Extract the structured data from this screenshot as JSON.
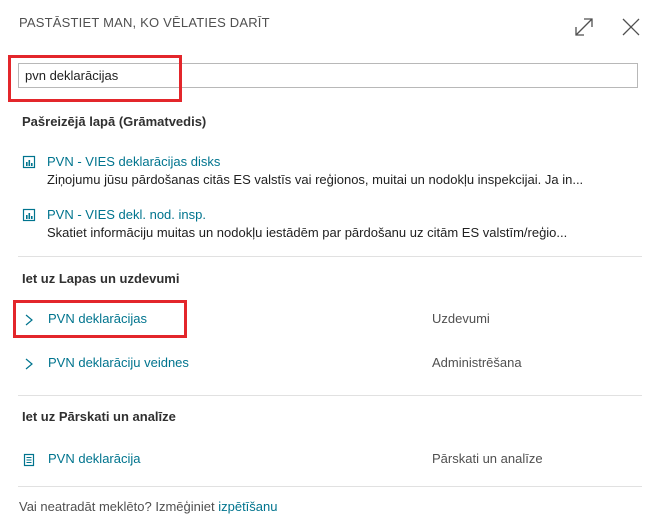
{
  "header": {
    "title": "PASTĀSTIET MAN, KO VĒLATIES DARĪT"
  },
  "search": {
    "value": "pvn deklarācijas"
  },
  "sections": {
    "current_page": {
      "title": "Pašreizējā lapā (Grāmatvedis)",
      "items": [
        {
          "title": "PVN - VIES deklarācijas disks",
          "description": "Ziņojumu jūsu pārdošanas citās ES valstīs vai reģionos, muitai un nodokļu inspekcijai. Ja in...",
          "icon": "report-icon"
        },
        {
          "title": "PVN - VIES dekl. nod. insp.",
          "description": "Skatiet informāciju muitas un nodokļu iestādēm par pārdošanu uz citām ES valstīm/reģio...",
          "icon": "report-icon"
        }
      ]
    },
    "pages_tasks": {
      "title": "Iet uz Lapas un uzdevumi",
      "items": [
        {
          "title": "PVN deklarācijas",
          "category": "Uzdevumi",
          "icon": "chevron-right-icon"
        },
        {
          "title": "PVN deklarāciju veidnes",
          "category": "Administrēšana",
          "icon": "chevron-right-icon"
        }
      ]
    },
    "reports": {
      "title": "Iet uz Pārskati un analīze",
      "items": [
        {
          "title": "PVN deklarācija",
          "category": "Pārskati un analīze",
          "icon": "document-icon"
        }
      ]
    }
  },
  "footer": {
    "text": "Vai neatradāt meklēto? Izmēģiniet",
    "link": "izpētīšanu"
  },
  "colors": {
    "link": "#00748e",
    "highlight": "#e3262b",
    "divider": "#e1e1e1"
  }
}
